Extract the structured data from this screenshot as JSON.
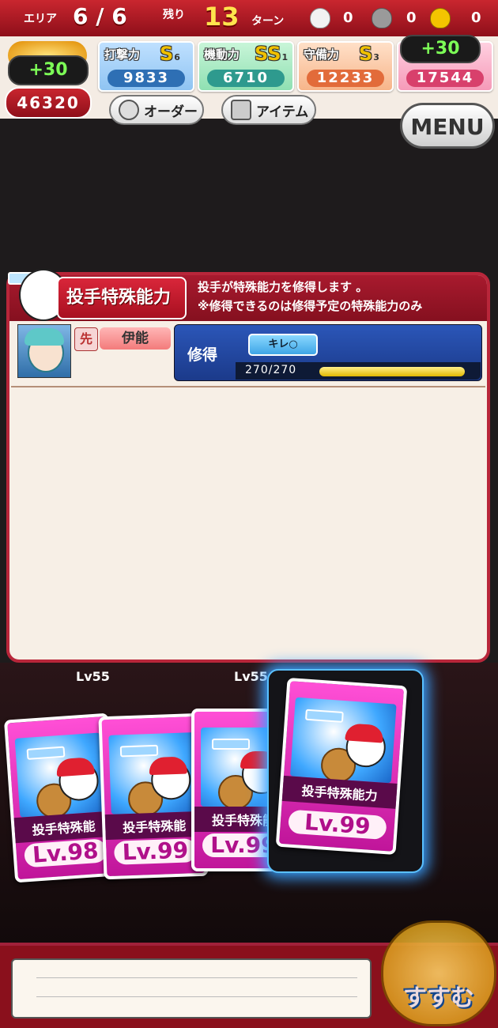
{
  "topbar": {
    "area_label": "エリア",
    "area_value": "6 / 6",
    "remain_label": "残り",
    "turns_value": "13",
    "turns_label": "ターン",
    "bag_counts": [
      "0",
      "0",
      "0"
    ]
  },
  "stats": [
    {
      "label": "打撃力",
      "rank": "S",
      "sub": "6",
      "value": "9833",
      "color": "#2e6fb4"
    },
    {
      "label": "機動力",
      "rank": "SS",
      "sub": "1",
      "value": "6710",
      "color": "#2e9a8e"
    },
    {
      "label": "守備力",
      "rank": "S",
      "sub": "3",
      "value": "12233",
      "color": "#e26b3a"
    },
    {
      "label": "",
      "rank": "",
      "sub": "",
      "value": "17544",
      "color": "#d8406c"
    }
  ],
  "left_bubble": "+30",
  "left_total": "46320",
  "right_bubble": "+30",
  "buttons": {
    "order": "オーダー",
    "item": "アイテム",
    "menu": "MENU"
  },
  "dialog": {
    "title": "投手特殊能力",
    "note_line1": "投手が特殊能力を修得します 。",
    "note_line2": "※修得できるのは修得予定の特殊能力のみ",
    "player": {
      "role": "先",
      "name": "伊能"
    },
    "learn_label": "修得",
    "ability": "キレ○",
    "exp_text": "270/270",
    "exp_fraction": 1.0
  },
  "cards": [
    {
      "name": "投手特殊能",
      "level": "Lv.98"
    },
    {
      "name": "投手特殊能",
      "level": "Lv.99"
    },
    {
      "name": "投手特殊能",
      "level": "Lv.99"
    },
    {
      "name": "投手特殊能力",
      "level": "Lv.99"
    }
  ],
  "bg_levels": [
    "55",
    "55"
  ],
  "bottom": {
    "susumu": "すすむ"
  },
  "colors": {
    "accent_red": "#b8263a",
    "card_pink": "#ff4fd6"
  }
}
